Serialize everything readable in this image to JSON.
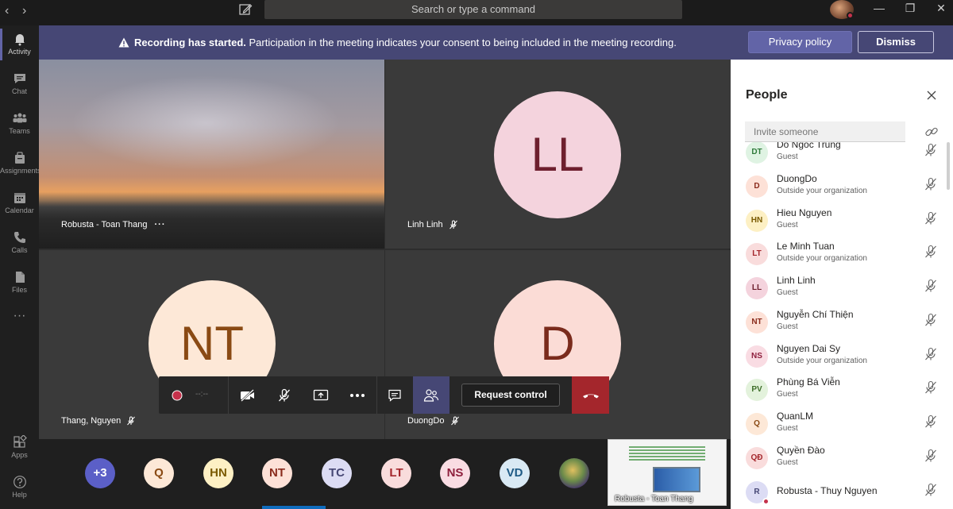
{
  "titlebar": {
    "back": "‹",
    "forward": "›",
    "search_placeholder": "Search or type a command",
    "minimize": "—",
    "maximize": "❐",
    "close": "✕"
  },
  "rail": [
    {
      "label": "Activity",
      "icon": "bell-icon"
    },
    {
      "label": "Chat",
      "icon": "chat-icon"
    },
    {
      "label": "Teams",
      "icon": "teams-icon"
    },
    {
      "label": "Assignments",
      "icon": "assignments-icon"
    },
    {
      "label": "Calendar",
      "icon": "calendar-icon"
    },
    {
      "label": "Calls",
      "icon": "phone-icon"
    },
    {
      "label": "Files",
      "icon": "files-icon"
    },
    {
      "label": "···",
      "icon": "more-icon"
    },
    {
      "label": "Apps",
      "icon": "apps-icon"
    },
    {
      "label": "Help",
      "icon": "help-icon"
    }
  ],
  "banner": {
    "bold": "Recording has started.",
    "text": " Participation in the meeting indicates your consent to being included in the meeting recording.",
    "privacy_label": "Privacy policy",
    "dismiss_label": "Dismiss",
    "color": "#464775"
  },
  "tiles": [
    {
      "name": "Robusta - Toan Thang",
      "more": "···"
    },
    {
      "name": "Linh Linh",
      "initials": "LL",
      "bg": "#f4d3dd",
      "fg": "#6e1f2e"
    },
    {
      "name": "Thang, Nguyen",
      "initials": "NT",
      "bg": "#fde8d7",
      "fg": "#8a4a14"
    },
    {
      "name": "DuongDo",
      "initials": "D",
      "bg": "#fbdcd6",
      "fg": "#7a2b1c"
    }
  ],
  "controls": {
    "rec_time": "--:--",
    "request_label": "Request control",
    "accent": "#464775",
    "hangup_color": "#a4262c"
  },
  "gallery": [
    {
      "initials": "+3",
      "bg": "#5b5fc7",
      "fg": "#ffffff"
    },
    {
      "initials": "Q",
      "bg": "#fde8d7",
      "fg": "#8a4a14"
    },
    {
      "initials": "HN",
      "bg": "#fdf0c4",
      "fg": "#7a5a00"
    },
    {
      "initials": "NT",
      "bg": "#fde1d7",
      "fg": "#8a2b1c"
    },
    {
      "initials": "TC",
      "bg": "#dcdcf4",
      "fg": "#464775"
    },
    {
      "initials": "LT",
      "bg": "#f9dcdc",
      "fg": "#a4262c"
    },
    {
      "initials": "NS",
      "bg": "#f9dce3",
      "fg": "#8e1f3d"
    },
    {
      "initials": "VD",
      "bg": "#d9e9f4",
      "fg": "#1e5a85"
    }
  ],
  "share_label": "Robusta - Toan Thang",
  "panel": {
    "title": "People",
    "invite_placeholder": "Invite someone",
    "people": [
      {
        "initials": "DT",
        "name": "Do Ngoc Trung",
        "role": "Guest",
        "bg": "#dff3e3",
        "fg": "#2f7a3a"
      },
      {
        "initials": "D",
        "name": "DuongDo",
        "role": "Outside your organization",
        "bg": "#fde1d7",
        "fg": "#8a2b1c"
      },
      {
        "initials": "HN",
        "name": "Hieu Nguyen",
        "role": "Guest",
        "bg": "#fdf0c4",
        "fg": "#7a5a00"
      },
      {
        "initials": "LT",
        "name": "Le Minh Tuan",
        "role": "Outside your organization",
        "bg": "#f9dcdc",
        "fg": "#a4262c"
      },
      {
        "initials": "LL",
        "name": "Linh Linh",
        "role": "Guest",
        "bg": "#f4d3dd",
        "fg": "#6e1f2e"
      },
      {
        "initials": "NT",
        "name": "Nguyễn Chí Thiện",
        "role": "Guest",
        "bg": "#fde1d7",
        "fg": "#8a2b1c"
      },
      {
        "initials": "NS",
        "name": "Nguyen Dai Sy",
        "role": "Outside your organization",
        "bg": "#f9dce3",
        "fg": "#8e1f3d"
      },
      {
        "initials": "PV",
        "name": "Phùng Bá Viễn",
        "role": "Guest",
        "bg": "#e3f2dc",
        "fg": "#3f6e2a"
      },
      {
        "initials": "Q",
        "name": "QuanLM",
        "role": "Guest",
        "bg": "#fde8d7",
        "fg": "#8a4a14"
      },
      {
        "initials": "QĐ",
        "name": "Quyền Đào",
        "role": "Guest",
        "bg": "#f9dcdc",
        "fg": "#a4262c"
      },
      {
        "initials": "R",
        "name": "Robusta - Thuy Nguyen",
        "role": "",
        "bg": "#dcdcf4",
        "fg": "#464775"
      }
    ]
  }
}
